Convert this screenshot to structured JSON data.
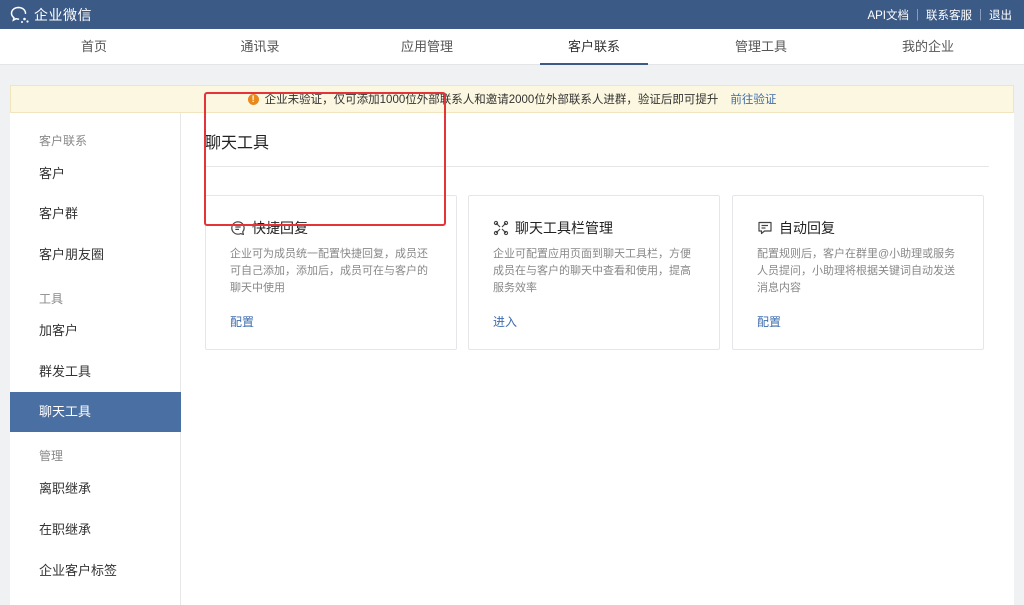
{
  "topbar": {
    "app_name": "企业微信",
    "links": [
      "API文档",
      "联系客服",
      "退出"
    ]
  },
  "nav": {
    "items": [
      "首页",
      "通讯录",
      "应用管理",
      "客户联系",
      "管理工具",
      "我的企业"
    ],
    "active": "客户联系"
  },
  "notice": {
    "text": "企业未验证，仅可添加1000位外部联系人和邀请2000位外部联系人进群，验证后即可提升",
    "link": "前往验证"
  },
  "sidebar": {
    "group1": "客户联系",
    "items1": [
      "客户",
      "客户群",
      "客户朋友圈"
    ],
    "group2": "工具",
    "items2": [
      "加客户",
      "群发工具",
      "聊天工具"
    ],
    "group3": "管理",
    "items3": [
      "离职继承",
      "在职继承",
      "企业客户标签"
    ],
    "active": "聊天工具"
  },
  "main": {
    "title": "聊天工具",
    "cards": [
      {
        "title": "快捷回复",
        "desc": "企业可为成员统一配置快捷回复，成员还可自己添加，添加后，成员可在与客户的聊天中使用",
        "action": "配置",
        "icon": "chat-bubble-icon"
      },
      {
        "title": "聊天工具栏管理",
        "desc": "企业可配置应用页面到聊天工具栏，方便成员在与客户的聊天中查看和使用，提高服务效率",
        "action": "进入",
        "icon": "toolbar-icon"
      },
      {
        "title": "自动回复",
        "desc": "配置规则后，客户在群里@小助理或服务人员提问，小助理将根据关键词自动发送消息内容",
        "action": "配置",
        "icon": "auto-reply-icon"
      }
    ]
  },
  "colors": {
    "topbar": "#3c5a86",
    "accent": "#4a6fa3",
    "link": "#3e6cad",
    "highlight": "#e5333a",
    "warning": "#e8891c"
  }
}
